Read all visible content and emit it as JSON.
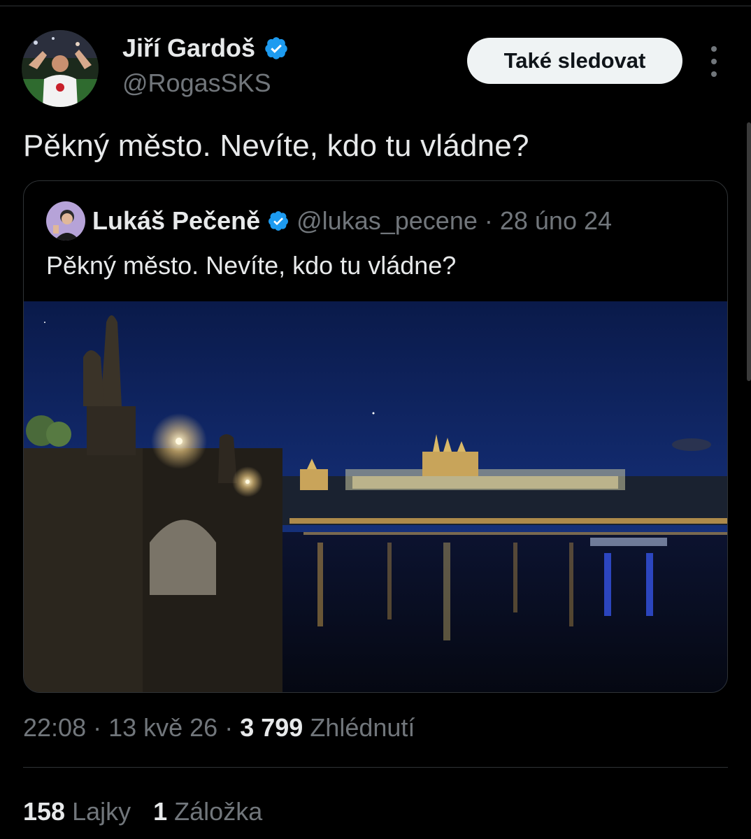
{
  "tweet": {
    "author": {
      "display_name": "Jiří Gardoš",
      "handle": "@RogasSKS",
      "verified": true,
      "avatar_icon": "user-avatar-photo"
    },
    "follow_label": "Také sledovat",
    "more_icon": "more-vertical-icon",
    "text": "Pěkný město. Nevíte, kdo tu vládne?",
    "quoted": {
      "display_name": "Lukáš Pečeně",
      "handle": "@lukas_pecene",
      "separator": "·",
      "date": "28 úno 24",
      "verified": true,
      "text": "Pěkný město. Nevíte, kdo tu vládne?",
      "media_icon": "night-city-river-photo"
    },
    "meta": {
      "time": "22:08",
      "separator": "·",
      "date": "13 kvě 26",
      "views_count": "3 799",
      "views_label": "Zhlédnutí"
    },
    "stats": {
      "likes_count": "158",
      "likes_label": "Lajky",
      "bookmarks_count": "1",
      "bookmarks_label": "Záložka"
    }
  },
  "colors": {
    "background": "#000000",
    "text_primary": "#e7e9ea",
    "text_secondary": "#71767b",
    "verified_blue": "#1d9bf0",
    "divider": "#2f3336",
    "button_bg": "#eff3f4"
  }
}
